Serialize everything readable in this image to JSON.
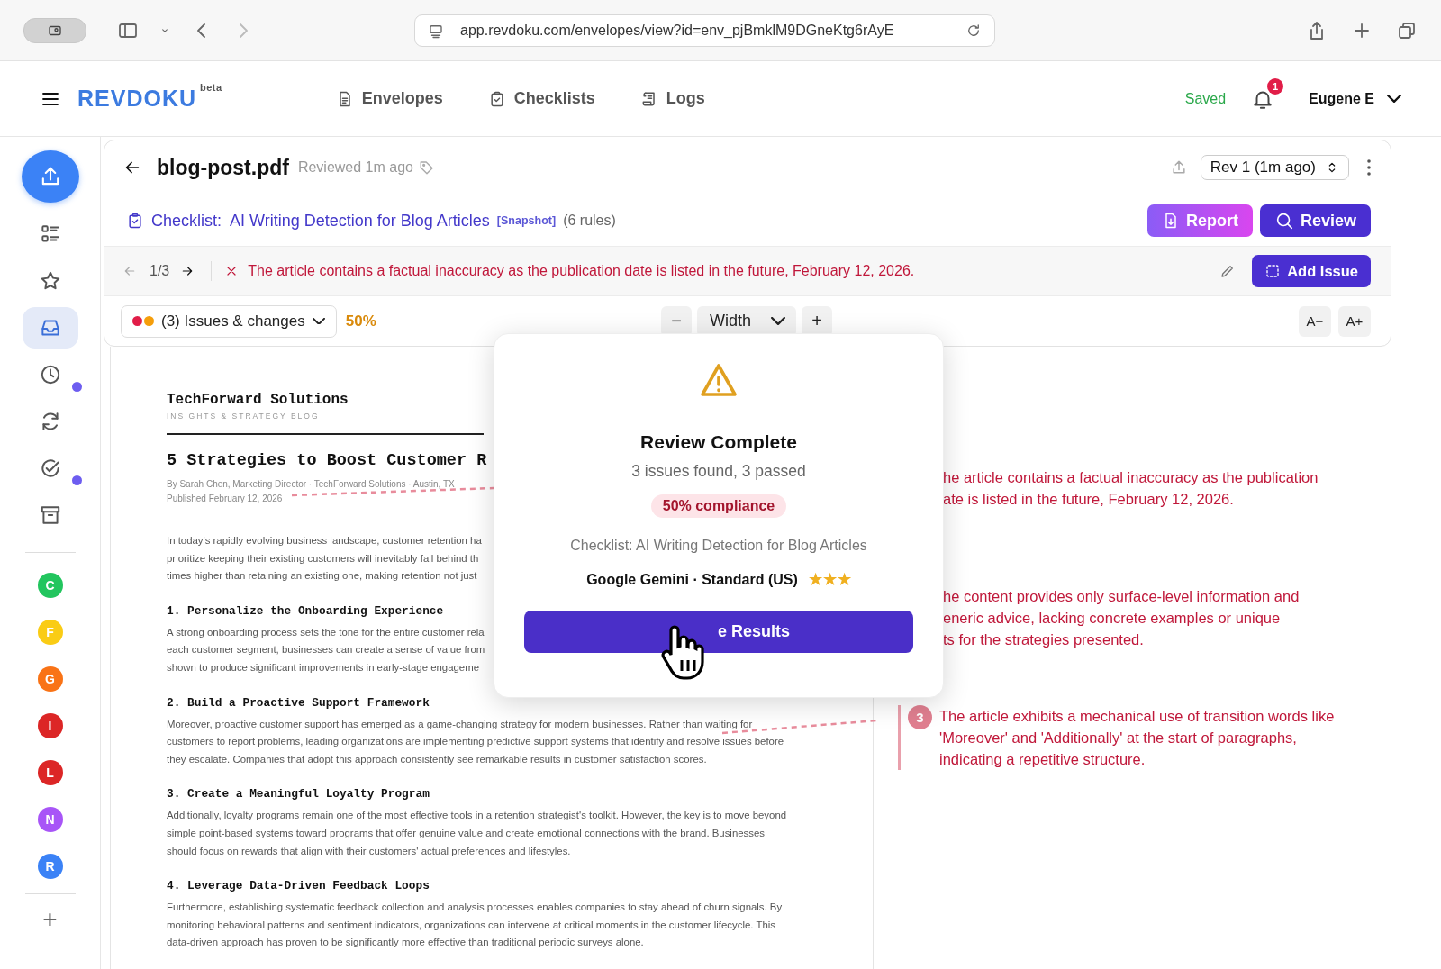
{
  "browser": {
    "profile_selected": true,
    "url": "app.revdoku.com/envelopes/view?id=env_pjBmklM9DGneKtg6rAyE"
  },
  "header": {
    "logo": "REVDOKU",
    "logo_badge": "beta",
    "nav": [
      {
        "label": "Envelopes",
        "kind": "document"
      },
      {
        "label": "Checklists",
        "kind": "clipboard"
      },
      {
        "label": "Logs",
        "kind": "scroll"
      }
    ],
    "save_status": "Saved",
    "notification_count": "1",
    "user": "Eugene E"
  },
  "sidebar": {
    "items": [
      {
        "kind": "upload",
        "selected": false,
        "dot": false
      },
      {
        "kind": "list",
        "selected": false,
        "dot": false
      },
      {
        "kind": "star",
        "selected": false,
        "dot": false
      },
      {
        "kind": "inbox",
        "selected": true,
        "dot": false
      },
      {
        "kind": "clock",
        "selected": false,
        "dot": true
      },
      {
        "kind": "refresh",
        "selected": false,
        "dot": false
      },
      {
        "kind": "check",
        "selected": false,
        "dot": true
      },
      {
        "kind": "archive",
        "selected": false,
        "dot": false
      }
    ],
    "avatars": [
      {
        "letter": "C",
        "color": "#22c55e"
      },
      {
        "letter": "F",
        "color": "#facc15"
      },
      {
        "letter": "G",
        "color": "#f97316"
      },
      {
        "letter": "I",
        "color": "#dc2626"
      },
      {
        "letter": "L",
        "color": "#dc2626"
      },
      {
        "letter": "N",
        "color": "#a855f7"
      },
      {
        "letter": "R",
        "color": "#3b82f6"
      }
    ],
    "add": "+"
  },
  "document_header": {
    "title": "blog-post.pdf",
    "status": "Reviewed 1m ago",
    "revision": "Rev 1 (1m ago)"
  },
  "checklist": {
    "prefix": "Checklist:",
    "name": "AI Writing Detection for Blog Articles",
    "tag": "[Snapshot]",
    "rules": "(6 rules)",
    "report_button": "Report",
    "review_button": "Review"
  },
  "issue_nav": {
    "position": "1/3",
    "message": "The article contains a factual inaccuracy as the publication date is listed in the future, February 12, 2026.",
    "add_button": "Add Issue"
  },
  "view_controls": {
    "dots": [
      {
        "color": "#e11d48"
      },
      {
        "color": "#f59e0b"
      }
    ],
    "filter_count": "(3)",
    "filter_label": "Issues & changes",
    "percent": "50%",
    "zoom_out": "−",
    "zoom": "Width",
    "zoom_in": "+",
    "font_smaller": "A−",
    "font_larger": "A+"
  },
  "document": {
    "company": "TechForward Solutions",
    "tagline": "INSIGHTS & STRATEGY BLOG",
    "title": "5 Strategies to Boost Customer R",
    "byline": "By Sarah Chen, Marketing Director · TechForward Solutions · Austin, TX",
    "published": "Published February 12, 2026",
    "intro": [
      "In today's rapidly evolving business landscape, customer retention ha",
      "prioritize keeping their existing customers will inevitably fall behind th",
      "times higher than retaining an existing one, making retention not just"
    ],
    "sections": [
      {
        "heading": "1. Personalize the Onboarding Experience",
        "lines": [
          "A strong onboarding process sets the tone for the entire customer rela",
          "each customer segment, businesses can create a sense of value from",
          "shown to produce significant improvements in early-stage engageme"
        ]
      },
      {
        "heading": "2. Build a Proactive Support Framework",
        "lines": [
          "Moreover, proactive customer support has emerged as a game-changing strategy for modern businesses. Rather than waiting for",
          "customers to report problems, leading organizations are implementing predictive support systems that identify and resolve issues before",
          "they escalate. Companies that adopt this approach consistently see remarkable results in customer satisfaction scores."
        ]
      },
      {
        "heading": "3. Create a Meaningful Loyalty Program",
        "lines": [
          "Additionally, loyalty programs remain one of the most effective tools in a retention strategist's toolkit. However, the key is to move beyond",
          "simple point-based systems toward programs that offer genuine value and create emotional connections with the brand. Businesses",
          "should focus on rewards that align with their customers' actual preferences and lifestyles."
        ]
      },
      {
        "heading": "4. Leverage Data-Driven Feedback Loops",
        "lines": [
          "Furthermore, establishing systematic feedback collection and analysis processes enables companies to stay ahead of churn signals. By",
          "monitoring behavioral patterns and sentiment indicators, organizations can intervene at critical moments in the customer lifecycle. This",
          "data-driven approach has proven to be significantly more effective than traditional periodic surveys alone."
        ]
      }
    ]
  },
  "annotations": [
    {
      "kind": "partial",
      "lines": [
        "he article contains a factual inaccuracy as the publication",
        "ate is listed in the future, February 12, 2026."
      ]
    },
    {
      "kind": "partial",
      "lines": [
        "he content provides only surface-level information and",
        "eneric advice, lacking concrete examples or unique",
        "ts for the strategies presented."
      ]
    },
    {
      "kind": "full",
      "number": "3",
      "text": "The article exhibits a mechanical use of transition words like 'Moreover' and 'Additionally' at the start of paragraphs, indicating a repetitive structure."
    }
  ],
  "dialog": {
    "title": "Review Complete",
    "summary": "3 issues found, 3 passed",
    "compliance": "50% compliance",
    "checklist": "Checklist: AI Writing Detection for Blog Articles",
    "model": "Google Gemini · Standard (US)",
    "stars": 3,
    "button": "e Results"
  }
}
